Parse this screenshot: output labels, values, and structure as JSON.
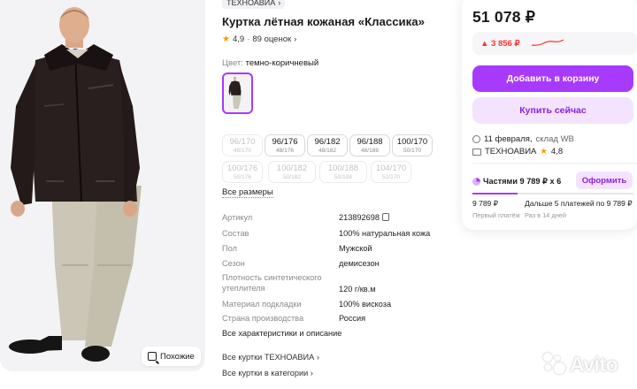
{
  "product": {
    "brand": "ТЕХНОАВИА",
    "title": "Куртка лётная кожаная «Классика»",
    "rating": "4,9",
    "reviews": "89 оценок",
    "color_label": "Цвет:",
    "color_value": "темно-коричневый"
  },
  "photo": {
    "similar_label": "Похожие"
  },
  "sizes": [
    {
      "ru": "96/170",
      "eu": "48/170",
      "available": false
    },
    {
      "ru": "96/176",
      "eu": "48/176",
      "available": true
    },
    {
      "ru": "96/182",
      "eu": "48/182",
      "available": true
    },
    {
      "ru": "96/188",
      "eu": "48/188",
      "available": true
    },
    {
      "ru": "100/170",
      "eu": "50/170",
      "available": true
    },
    {
      "ru": "100/176",
      "eu": "50/176",
      "available": false
    },
    {
      "ru": "100/182",
      "eu": "50/182",
      "available": false
    },
    {
      "ru": "100/188",
      "eu": "50/188",
      "available": false
    },
    {
      "ru": "104/170",
      "eu": "52/170",
      "available": false
    }
  ],
  "all_sizes_label": "Все размеры",
  "specs": [
    {
      "key": "Артикул",
      "value": "213892698"
    },
    {
      "key": "Состав",
      "value": "100% натуральная кожа"
    },
    {
      "key": "Пол",
      "value": "Мужской"
    },
    {
      "key": "Сезон",
      "value": "демисезон"
    },
    {
      "key": "Плотность синтетического утеплителя",
      "value": "120 г/кв.м"
    },
    {
      "key": "Материал подкладки",
      "value": "100% вискоза"
    },
    {
      "key": "Страна производства",
      "value": "Россия"
    }
  ],
  "all_chars_label": "Все характеристики и описание",
  "links": {
    "brand_all": "Все куртки ТЕХНОАВИА",
    "category_all": "Все куртки в категории"
  },
  "buy": {
    "price": "51 078 ₽",
    "price_delta": "▲ 3 856 ₽",
    "add_to_cart": "Добавить в корзину",
    "buy_now": "Купить сейчас",
    "delivery_date": "11 февраля,",
    "delivery_warehouse": "склад WB",
    "seller": "ТЕХНОАВИА",
    "seller_rating": "4,8"
  },
  "installments": {
    "title": "Частями 9 789 ₽ x 6",
    "button": "Оформить",
    "first_amount": "9 789 ₽",
    "first_label": "Первый платёж",
    "rest_amount": "Дальше 5 платежей по 9 789 ₽",
    "rest_label": "Раз в 14 дней",
    "progress": 0.28
  },
  "watermark": "Avito",
  "colors": {
    "accent": "#a73afd",
    "accent_light": "#f4e3ff",
    "price_up": "#ff3333",
    "star": "#ff9900"
  }
}
